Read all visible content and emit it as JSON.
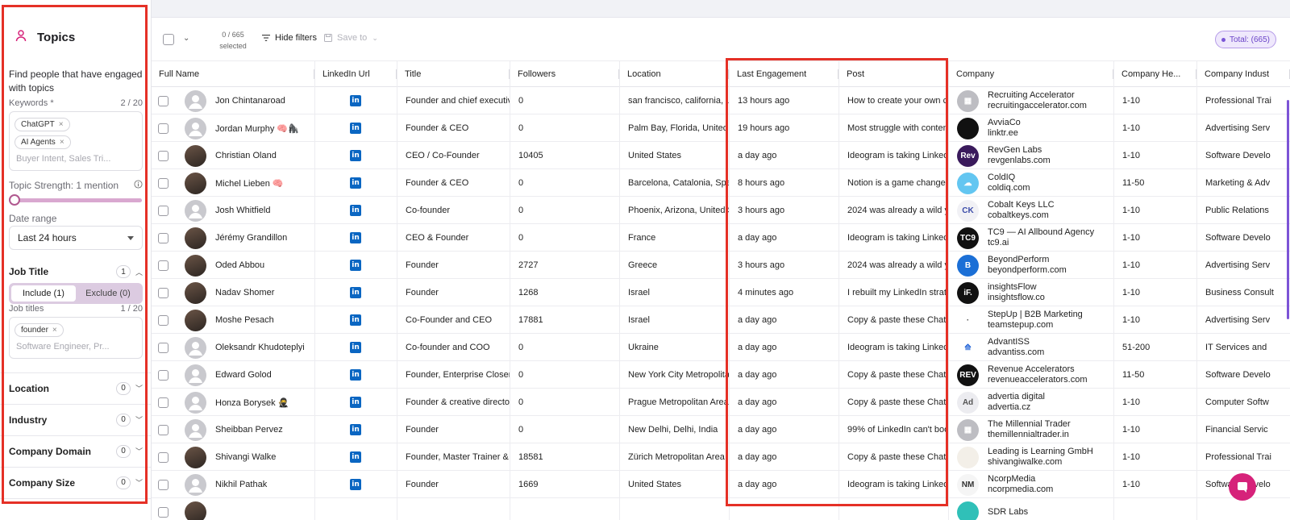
{
  "sidebar": {
    "title": "Topics",
    "description": "Find people that have engaged with topics",
    "keywords_label": "Keywords *",
    "keywords_count": "2 / 20",
    "keywords": [
      "ChatGPT",
      "AI Agents"
    ],
    "keywords_placeholder": "Buyer Intent, Sales Tri...",
    "topic_strength": "Topic Strength: 1 mention",
    "date_range_label": "Date range",
    "date_range_value": "Last 24 hours",
    "job_title": {
      "label": "Job Title",
      "count": "1"
    },
    "include_label": "Include (1)",
    "exclude_label": "Exclude (0)",
    "job_titles_label": "Job titles",
    "job_titles_count": "1 / 20",
    "job_titles": [
      "founder"
    ],
    "job_titles_placeholder": "Software Engineer, Pr...",
    "location": {
      "label": "Location",
      "count": "0"
    },
    "industry": {
      "label": "Industry",
      "count": "0"
    },
    "company_domain": {
      "label": "Company Domain",
      "count": "0"
    },
    "company_size": {
      "label": "Company Size",
      "count": "0"
    }
  },
  "toolbar": {
    "selected_count": "0 / 665",
    "selected_label": "selected",
    "hide_filters": "Hide filters",
    "save_to": "Save to",
    "total": "Total: (665)"
  },
  "columns": [
    "Full Name",
    "LinkedIn Url",
    "Title",
    "Followers",
    "Location",
    "Last Engagement",
    "Post",
    "Company",
    "Company He...",
    "Company Indust"
  ],
  "rows": [
    {
      "name": "Jon Chintanaroad",
      "title": "Founder and chief executive o",
      "followers": "0",
      "location": "san francisco, california, unite",
      "last": "13 hours ago",
      "post": "How to create your own cu",
      "company": "Recruiting Accelerator",
      "domain": "recruitingaccelerator.com",
      "size": "1-10",
      "industry": "Professional Trai"
    },
    {
      "name": "Jordan Murphy 🧠🦍",
      "title": "Founder & CEO",
      "followers": "0",
      "location": "Palm Bay, Florida, United Sta",
      "last": "19 hours ago",
      "post": "Most struggle with content",
      "company": "AvviaCo",
      "domain": "linktr.ee",
      "size": "1-10",
      "industry": "Advertising Serv"
    },
    {
      "name": "Christian Oland",
      "title": "CEO / Co-Founder",
      "followers": "10405",
      "location": "United States",
      "last": "a day ago",
      "post": "Ideogram is taking Linkedir",
      "company": "RevGen Labs",
      "domain": "revgenlabs.com",
      "size": "1-10",
      "industry": "Software Develo"
    },
    {
      "name": "Michel Lieben 🧠",
      "title": "Founder & CEO",
      "followers": "0",
      "location": "Barcelona, Catalonia, Spain",
      "last": "8 hours ago",
      "post": "Notion is a game changer f",
      "company": "ColdIQ",
      "domain": "coldiq.com",
      "size": "11-50",
      "industry": "Marketing & Adv"
    },
    {
      "name": "Josh Whitfield",
      "title": "Co-founder",
      "followers": "0",
      "location": "Phoenix, Arizona, United Stat",
      "last": "3 hours ago",
      "post": "2024 was already a wild ye",
      "company": "Cobalt Keys LLC",
      "domain": "cobaltkeys.com",
      "size": "1-10",
      "industry": "Public Relations"
    },
    {
      "name": "Jérémy Grandillon",
      "title": "CEO & Founder",
      "followers": "0",
      "location": "France",
      "last": "a day ago",
      "post": "Ideogram is taking Linkedir",
      "company": "TC9 — AI Allbound Agency",
      "domain": "tc9.ai",
      "size": "1-10",
      "industry": "Software Develo"
    },
    {
      "name": "Oded Abbou",
      "title": "Founder",
      "followers": "2727",
      "location": "Greece",
      "last": "3 hours ago",
      "post": "2024 was already a wild ye",
      "company": "BeyondPerform",
      "domain": "beyondperform.com",
      "size": "1-10",
      "industry": "Advertising Serv"
    },
    {
      "name": "Nadav Shomer",
      "title": "Founder",
      "followers": "1268",
      "location": "Israel",
      "last": "4 minutes ago",
      "post": "I rebuilt my LinkedIn strateg",
      "company": "insightsFlow",
      "domain": "insightsflow.co",
      "size": "1-10",
      "industry": "Business Consult"
    },
    {
      "name": "Moshe Pesach",
      "title": "Co-Founder and CEO",
      "followers": "17881",
      "location": "Israel",
      "last": "a day ago",
      "post": "Copy & paste these ChatG",
      "company": "StepUp | B2B Marketing",
      "domain": "teamstepup.com",
      "size": "1-10",
      "industry": "Advertising Serv"
    },
    {
      "name": "Oleksandr Khudoteplyi",
      "title": "Co-founder and COO",
      "followers": "0",
      "location": "Ukraine",
      "last": "a day ago",
      "post": "Ideogram is taking Linkedir",
      "company": "AdvantISS",
      "domain": "advantiss.com",
      "size": "51-200",
      "industry": "IT Services and"
    },
    {
      "name": "Edward Golod",
      "title": "Founder, Enterprise Closer | C",
      "followers": "0",
      "location": "New York City Metropolitan A",
      "last": "a day ago",
      "post": "Copy & paste these ChatG",
      "company": "Revenue Accelerators",
      "domain": "revenueaccelerators.com",
      "size": "11-50",
      "industry": "Software Develo"
    },
    {
      "name": "Honza Borysek 🥷",
      "title": "Founder & creative director",
      "followers": "0",
      "location": "Prague Metropolitan Area",
      "last": "a day ago",
      "post": "Copy & paste these ChatG",
      "company": "advertia digital",
      "domain": "advertia.cz",
      "size": "1-10",
      "industry": "Computer Softw"
    },
    {
      "name": "Sheibban Pervez",
      "title": "Founder",
      "followers": "0",
      "location": "New Delhi, Delhi, India",
      "last": "a day ago",
      "post": "99% of LinkedIn can't bool",
      "company": "The Millennial Trader",
      "domain": "themillennialtrader.in",
      "size": "1-10",
      "industry": "Financial Servic"
    },
    {
      "name": "Shivangi Walke",
      "title": "Founder, Master Trainer & Lea",
      "followers": "18581",
      "location": "Zürich Metropolitan Area",
      "last": "a day ago",
      "post": "Copy & paste these ChatG",
      "company": "Leading is Learning GmbH",
      "domain": "shivangiwalke.com",
      "size": "1-10",
      "industry": "Professional Trai"
    },
    {
      "name": "Nikhil Pathak",
      "title": "Founder",
      "followers": "1669",
      "location": "United States",
      "last": "a day ago",
      "post": "Ideogram is taking Linkedir",
      "company": "NcorpMedia",
      "domain": "ncorpmedia.com",
      "size": "1-10",
      "industry": "Software Develo"
    },
    {
      "name": "",
      "title": "",
      "followers": "",
      "location": "",
      "last": "",
      "post": "",
      "company": "SDR Labs",
      "domain": "",
      "size": "",
      "industry": ""
    }
  ],
  "colors": {
    "accent": "#7a56d6",
    "highlight": "#e53026",
    "linkedin": "#0a66c2",
    "fab": "#d6227a"
  }
}
